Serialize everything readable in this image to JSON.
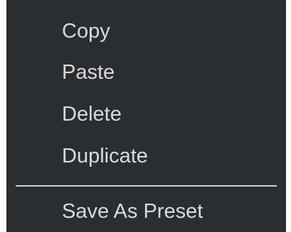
{
  "context_menu": {
    "items": [
      {
        "label": "Copy"
      },
      {
        "label": "Paste"
      },
      {
        "label": "Delete"
      },
      {
        "label": "Duplicate"
      }
    ],
    "save_as_preset_label": "Save As Preset"
  },
  "colors": {
    "menu_background": "#2b2e31",
    "menu_text": "#d9dadb",
    "separator": "#cfd0d1"
  }
}
